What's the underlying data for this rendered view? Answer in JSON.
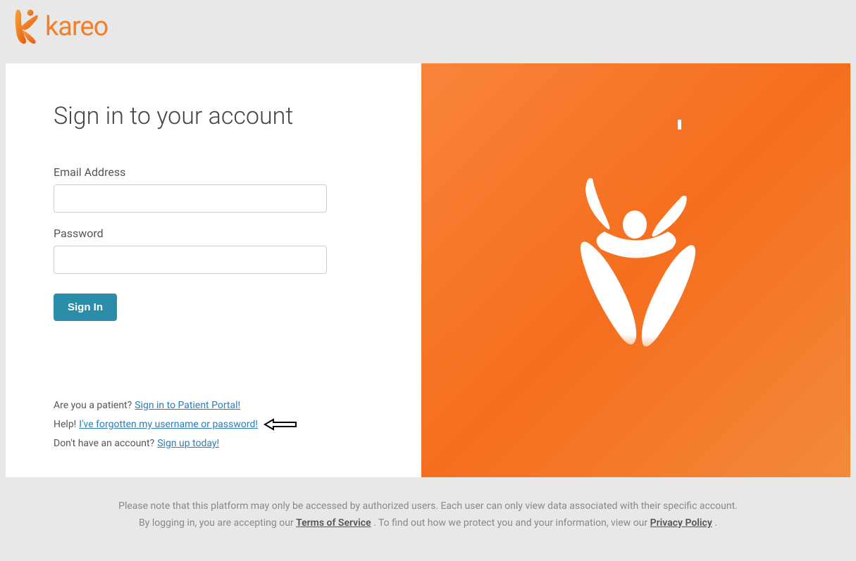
{
  "brand": {
    "name": "kareo"
  },
  "form": {
    "title": "Sign in to your account",
    "email_label": "Email Address",
    "password_label": "Password",
    "signin_button": "Sign In"
  },
  "links": {
    "patient_prefix": "Are you a patient?",
    "patient_link": "Sign in to Patient Portal!",
    "help_prefix": "Help!",
    "forgot_link": "I've forgotten my username or password!",
    "signup_prefix": "Don't have an account?",
    "signup_link": "Sign up today!"
  },
  "footer": {
    "line1": "Please note that this platform may only be accessed by authorized users. Each user can only view data associated with their specific account.",
    "line2_a": "By logging in, you are accepting our ",
    "terms": "Terms of Service",
    "line2_b": ". To find out how we protect you and your information, view our ",
    "privacy": "Privacy Policy",
    "line2_c": "."
  }
}
